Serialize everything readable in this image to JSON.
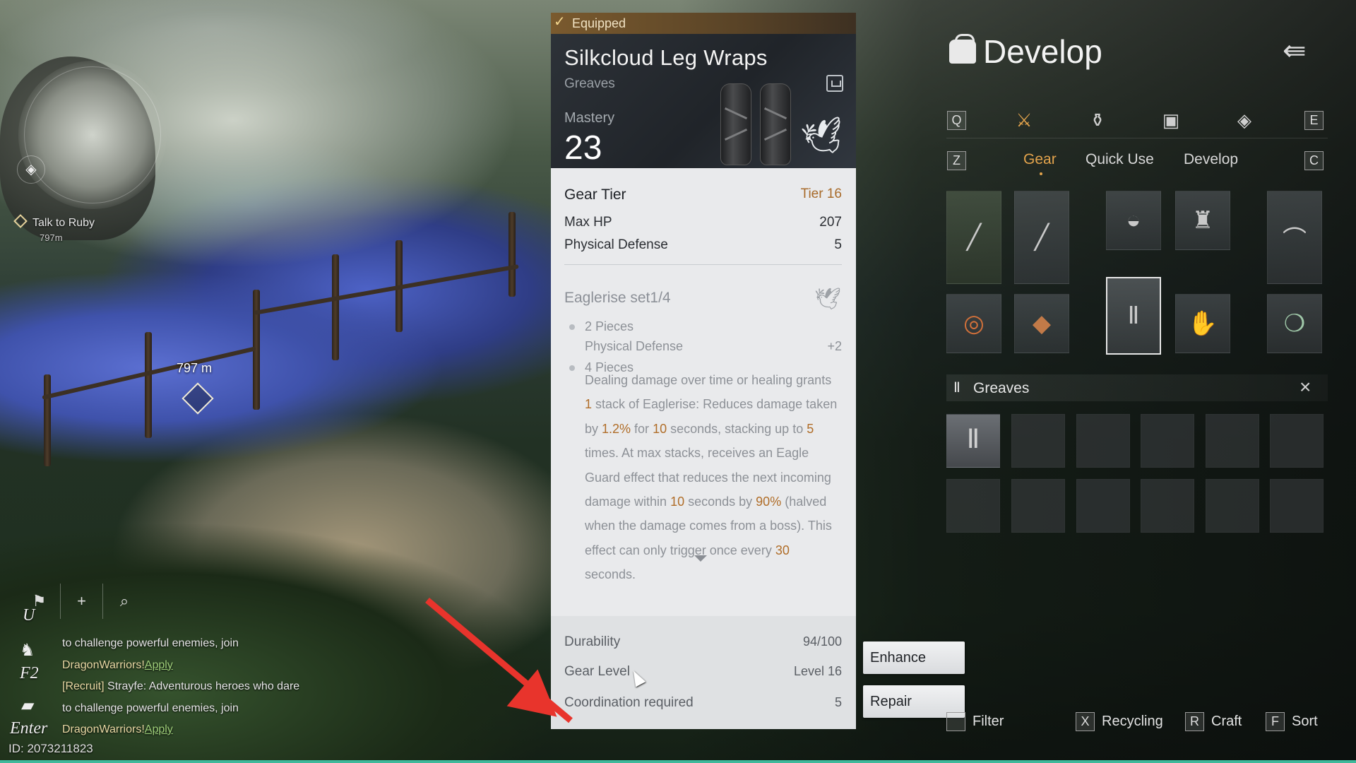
{
  "hud": {
    "quest": {
      "label": "Talk to Ruby",
      "distance": "797m"
    },
    "waypoint_distance": "797 m",
    "chat_keys": {
      "u": "U",
      "f2": "F2",
      "enter": "Enter"
    },
    "chat_lines": [
      {
        "text": "to challenge powerful enemies, join"
      },
      {
        "guild": "DragonWarriors!",
        "apply": "Apply"
      },
      {
        "tag": "[Recruit]",
        "text": " Strayfe: Adventurous heroes who dare"
      },
      {
        "text": "to challenge powerful enemies, join"
      },
      {
        "guild": "DragonWarriors!",
        "apply": "Apply"
      }
    ],
    "player_id": "ID: 2073211823"
  },
  "tooltip": {
    "equipped_label": "Equipped",
    "item_name": "Silkcloud Leg Wraps",
    "item_type": "Greaves",
    "mastery_label": "Mastery",
    "mastery_value": "23",
    "gear_tier_label": "Gear Tier",
    "gear_tier_value": "Tier 16",
    "stats": [
      {
        "label": "Max HP",
        "value": "207"
      },
      {
        "label": "Physical Defense",
        "value": "5"
      }
    ],
    "set": {
      "title": "Eaglerise set1/4",
      "pieces2_label": "2 Pieces",
      "pieces2_stat": "Physical Defense",
      "pieces2_value": "+2",
      "pieces4_label": "4 Pieces",
      "description_segments": [
        {
          "t": "Dealing damage over time or healing grants ",
          "hl": false
        },
        {
          "t": "1",
          "hl": true
        },
        {
          "t": " stack of Eaglerise: Reduces damage taken by ",
          "hl": false
        },
        {
          "t": "1.2%",
          "hl": true
        },
        {
          "t": " for ",
          "hl": false
        },
        {
          "t": "10",
          "hl": true
        },
        {
          "t": " seconds, stacking up to ",
          "hl": false
        },
        {
          "t": "5",
          "hl": true
        },
        {
          "t": " times. At max stacks, receives an Eagle Guard effect that reduces the next incoming damage within ",
          "hl": false
        },
        {
          "t": "10",
          "hl": true
        },
        {
          "t": " seconds by ",
          "hl": false
        },
        {
          "t": "90%",
          "hl": true
        },
        {
          "t": " (halved when the damage comes from a boss). This effect can only trigger once every ",
          "hl": false
        },
        {
          "t": "30",
          "hl": true
        },
        {
          "t": " seconds.",
          "hl": false
        }
      ]
    },
    "footer": [
      {
        "label": "Durability",
        "value": "94/100"
      },
      {
        "label": "Gear Level",
        "value": "Level 16"
      },
      {
        "label": "Coordination required",
        "value": "5"
      }
    ]
  },
  "actions": {
    "enhance": "Enhance",
    "repair": "Repair"
  },
  "develop": {
    "title": "Develop",
    "hotkeys": {
      "q": "Q",
      "e": "E",
      "z": "Z",
      "c": "C"
    },
    "category_icons": [
      "crossed-swords-icon",
      "potion-icon",
      "chest-icon",
      "gem-pin-icon"
    ],
    "tabs": [
      "Gear",
      "Quick Use",
      "Develop"
    ],
    "active_tab": "Gear",
    "section_title": "Greaves",
    "commands": [
      {
        "key": "",
        "label": "Filter"
      },
      {
        "key": "X",
        "label": "Recycling"
      },
      {
        "key": "R",
        "label": "Craft"
      },
      {
        "key": "F",
        "label": "Sort"
      }
    ]
  },
  "colors": {
    "accent": "#e2a34c",
    "highlight": "#b06d28",
    "annotation_arrow": "#e8342c"
  }
}
